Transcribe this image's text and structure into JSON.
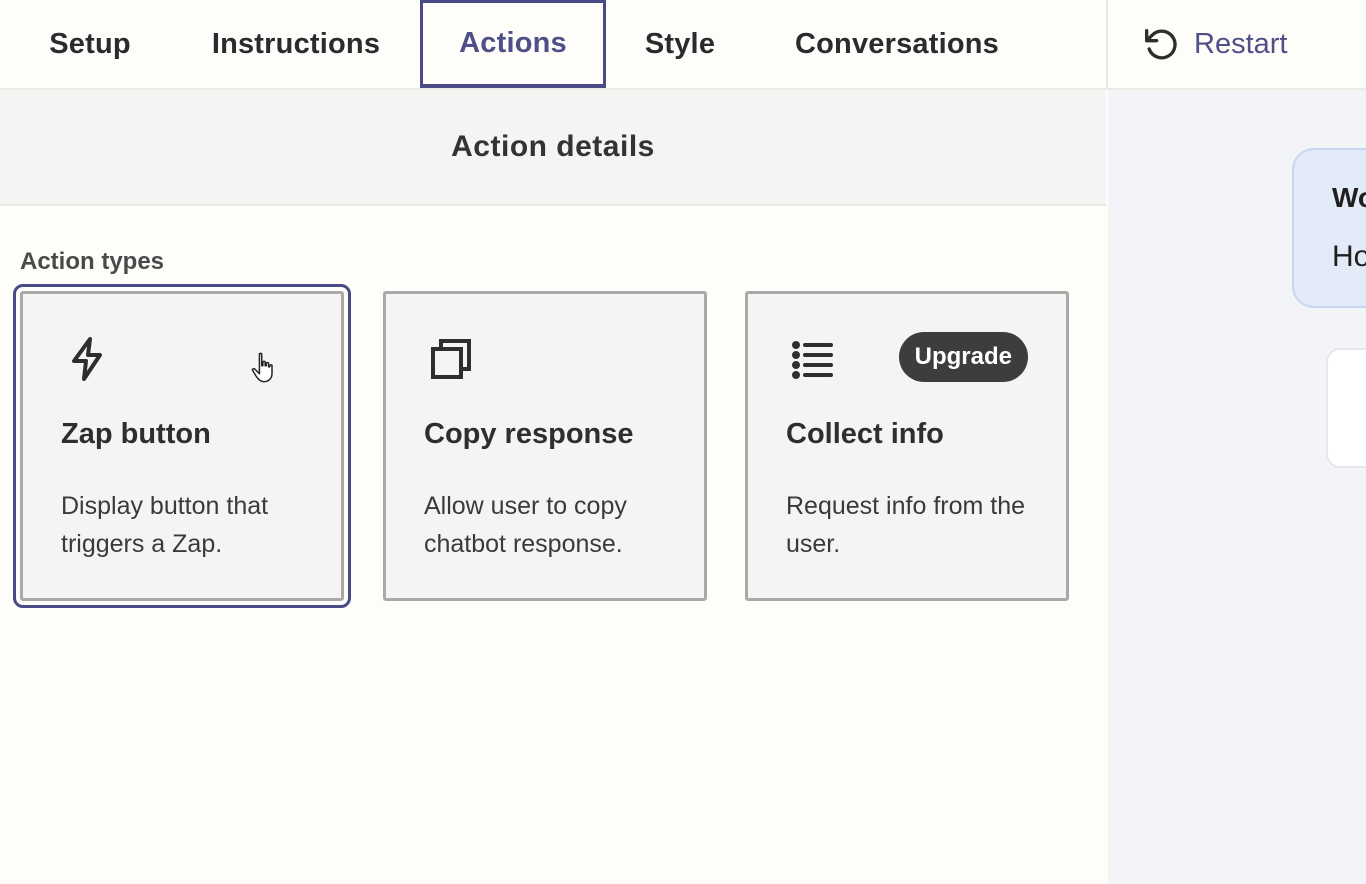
{
  "tabs": [
    {
      "label": "Setup"
    },
    {
      "label": "Instructions"
    },
    {
      "label": "Actions"
    },
    {
      "label": "Style"
    },
    {
      "label": "Conversations"
    }
  ],
  "active_tab": "Actions",
  "restart": {
    "label": "Restart",
    "icon": "rotate-ccw-icon"
  },
  "section": {
    "title": "Action details"
  },
  "action_types": {
    "label": "Action types",
    "cards": [
      {
        "icon": "lightning-bolt-icon",
        "title": "Zap button",
        "description": "Display button that triggers a Zap.",
        "selected": true
      },
      {
        "icon": "copy-icon",
        "title": "Copy response",
        "description": "Allow user to copy chatbot response.",
        "selected": false
      },
      {
        "icon": "list-icon",
        "title": "Collect info",
        "description": "Request info from the user.",
        "badge": "Upgrade",
        "selected": false
      }
    ]
  },
  "preview": {
    "bubble_title": "Wo",
    "bubble_text": "Ho"
  },
  "colors": {
    "accent": "#4a4a86",
    "badge_bg": "#3d3d3b",
    "preview_bg": "#f2f4f8",
    "bubble_bg": "#e4ebf8"
  }
}
